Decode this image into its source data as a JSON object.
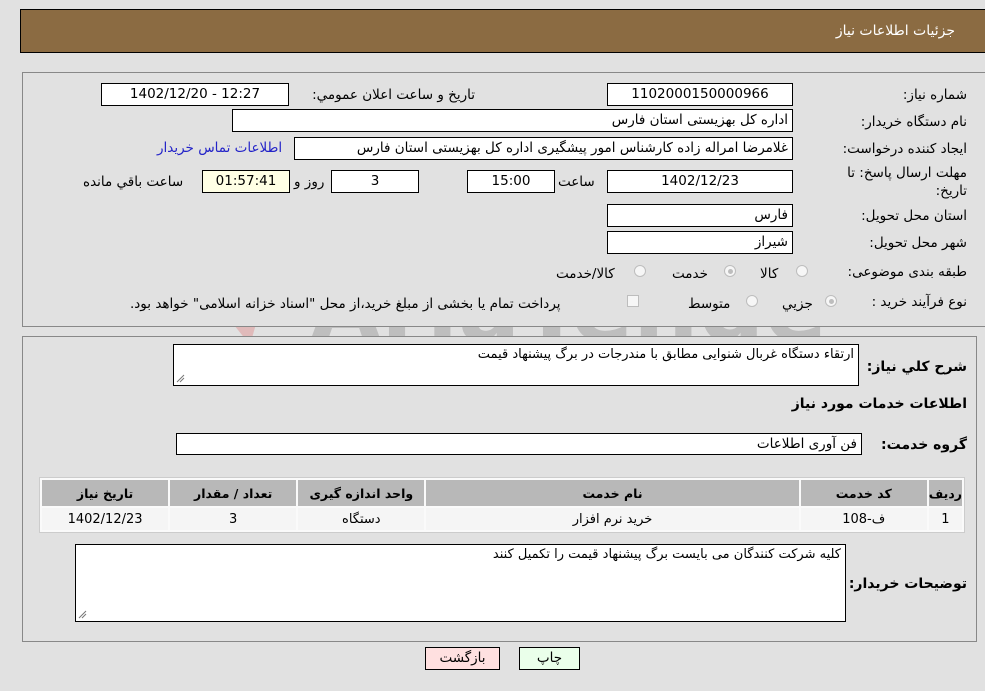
{
  "header": {
    "title": "جزئیات اطلاعات نیاز"
  },
  "form": {
    "need_number": {
      "label": "شماره نیاز:",
      "value": "1102000150000966"
    },
    "announce_datetime": {
      "label": "تاریخ و ساعت اعلان عمومي:",
      "value": "1402/12/20 - 12:27"
    },
    "buyer_org": {
      "label": "نام دستگاه خریدار:",
      "value": "اداره کل بهزیستی استان فارس"
    },
    "requester": {
      "label": "ایجاد کننده درخواست:",
      "value": "غلامرضا امراله زاده کارشناس امور پیشگیری اداره کل بهزیستی استان فارس"
    },
    "buyer_contact_link": "اطلاعات تماس خریدار",
    "deadline": {
      "label": "مهلت ارسال پاسخ: تا تاریخ:",
      "date": "1402/12/23",
      "time_label": "ساعت",
      "time": "15:00",
      "days": "3",
      "days_label": "روز و",
      "remaining": "01:57:41",
      "remaining_label": "ساعت باقي مانده"
    },
    "delivery_province": {
      "label": "استان محل تحویل:",
      "value": "فارس"
    },
    "delivery_city": {
      "label": "شهر محل تحویل:",
      "value": "شیراز"
    },
    "category": {
      "label": "طبقه بندی موضوعی:",
      "options": [
        "کالا",
        "خدمت",
        "کالا/خدمت"
      ],
      "selected": "خدمت"
    },
    "purchase_process": {
      "label": "نوع فرآیند خرید :",
      "options": [
        "جزیي",
        "متوسط"
      ],
      "selected": "جزیي",
      "payment_note": "پرداخت تمام یا بخشی از مبلغ خرید،از محل \"اسناد خزانه اسلامی\" خواهد بود."
    }
  },
  "details": {
    "description_label": "شرح کلي نیاز:",
    "description": "ارتقاء دستگاه غربال شنوایی مطابق با مندرجات در برگ پیشنهاد قیمت",
    "services_heading": "اطلاعات خدمات مورد نیاز",
    "service_group_label": "گروه خدمت:",
    "service_group": "فن آوری اطلاعات",
    "table": {
      "headers": [
        "ردیف",
        "کد خدمت",
        "نام خدمت",
        "واحد اندازه گیری",
        "تعداد / مقدار",
        "تاریخ نیاز"
      ],
      "rows": [
        [
          "1",
          "ف-108",
          "خرید نرم افزار",
          "دستگاه",
          "3",
          "1402/12/23"
        ]
      ]
    },
    "buyer_notes_label": "توضیحات خریدار:",
    "buyer_notes": "کلیه شرکت کنندگان می بایست برگ پیشنهاد قیمت را تکمیل کنند"
  },
  "buttons": {
    "print": "چاپ",
    "back": "بازگشت"
  },
  "watermark": "AriaTender.neT",
  "colors": {
    "header_bg": "#8b6b42",
    "link": "#2323c8",
    "print_bg": "#eaffea",
    "back_bg": "#ffe0e0",
    "remaining_bg": "#ffffe5"
  }
}
